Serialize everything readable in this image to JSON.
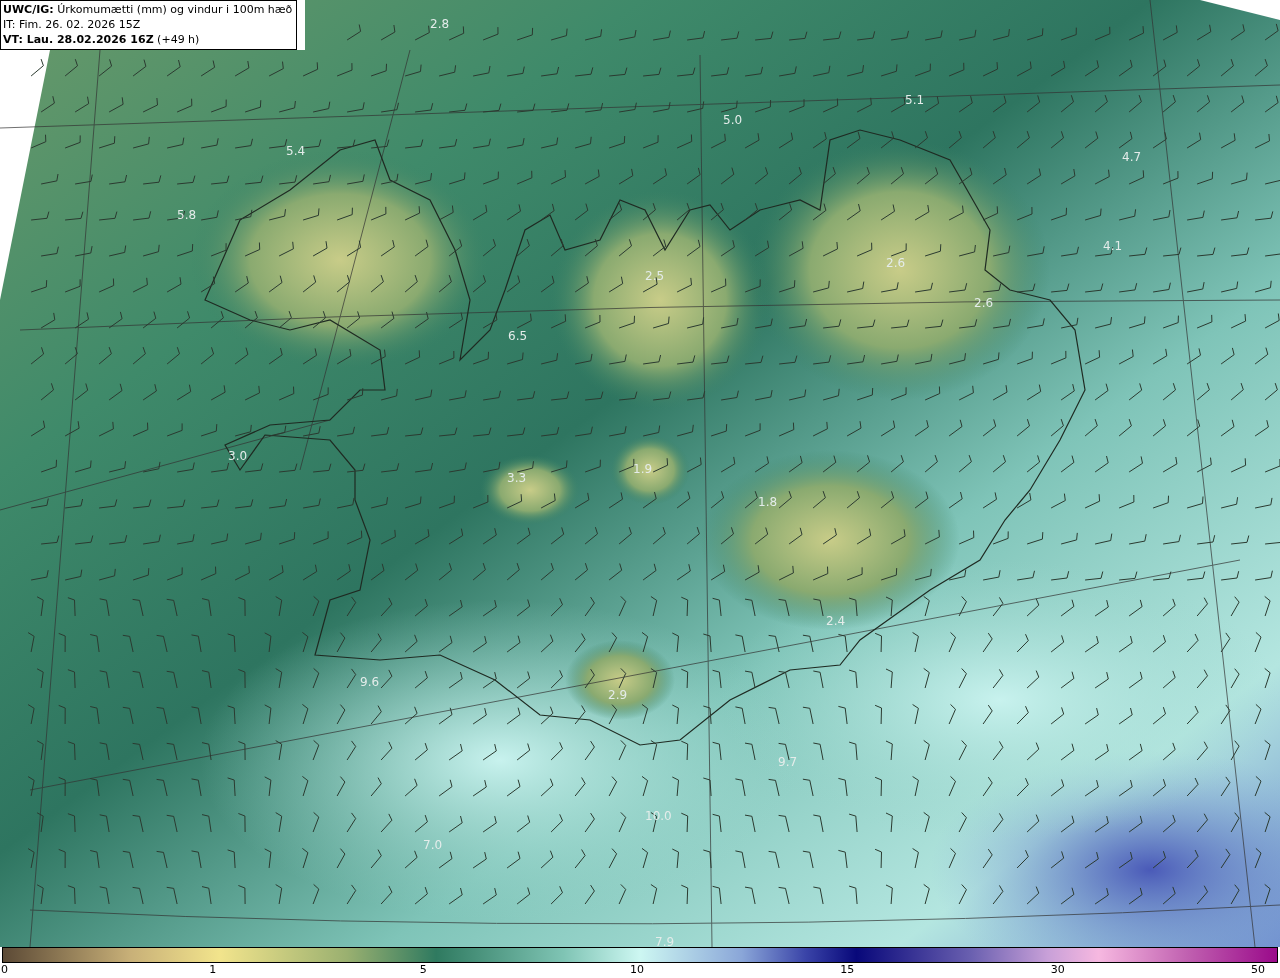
{
  "header": {
    "title": "**UWC/IG:** Úrkomumætti (mm) og vindur i 100m hæð",
    "issue_time": "IT: Fim. 26. 02. 2026 15Z",
    "valid_time": "**VT: Lau. 28.02.2026 16Z** (+49 h)"
  },
  "map": {
    "value_labels": [
      "2.8",
      "5.1",
      "5.0",
      "5.4",
      "4.7",
      "5.8",
      "4.1",
      "2.6",
      "2.5",
      "2.6",
      "6.5",
      "3.0",
      "3.3",
      "1.9",
      "1.8",
      "2.4",
      "9.6",
      "2.9",
      "9.7",
      "10.0",
      "7.0",
      "7.9"
    ]
  },
  "colorbar": {
    "ticks": [
      "0",
      "1",
      "5",
      "10",
      "15",
      "30",
      "50"
    ]
  }
}
